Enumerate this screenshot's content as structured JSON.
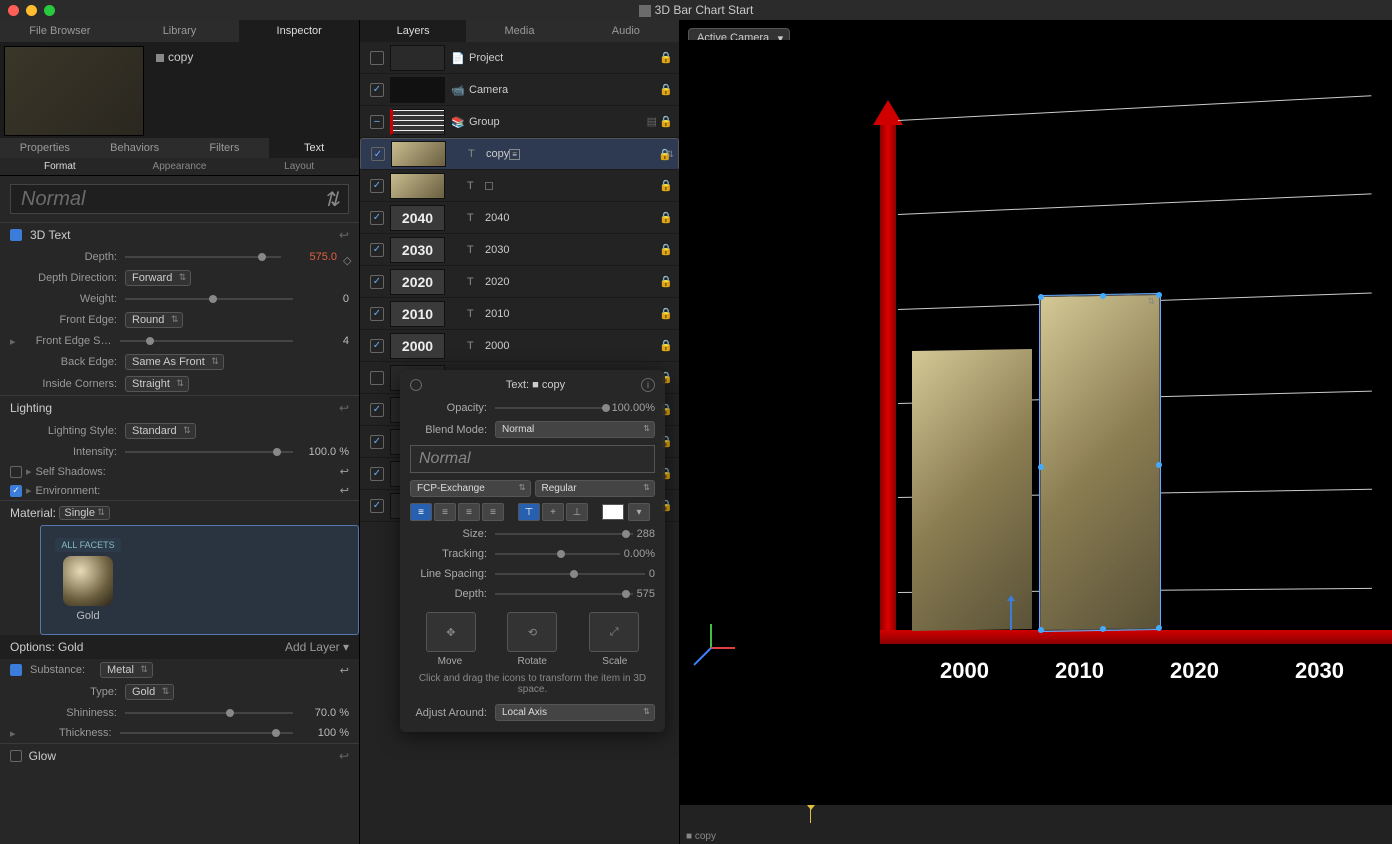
{
  "window": {
    "title": "3D Bar Chart Start"
  },
  "left_tabs": [
    "File Browser",
    "Library",
    "Inspector"
  ],
  "left_tab_active": 2,
  "preview": {
    "name": "copy"
  },
  "subtabs": [
    "Properties",
    "Behaviors",
    "Filters",
    "Text"
  ],
  "subtab_active": 3,
  "minitabs": [
    "Format",
    "Appearance",
    "Layout"
  ],
  "minitab_active": 0,
  "font_preview": "Normal",
  "sections": {
    "text3d": {
      "title": "3D Text",
      "depth_label": "Depth:",
      "depth_value": "575.0",
      "depth_dir_label": "Depth Direction:",
      "depth_dir_value": "Forward",
      "weight_label": "Weight:",
      "weight_value": "0",
      "front_edge_label": "Front Edge:",
      "front_edge_value": "Round",
      "front_edge_s_label": "Front Edge S…",
      "front_edge_s_value": "4",
      "back_edge_label": "Back Edge:",
      "back_edge_value": "Same As Front",
      "inside_label": "Inside Corners:",
      "inside_value": "Straight"
    },
    "lighting": {
      "title": "Lighting",
      "style_label": "Lighting Style:",
      "style_value": "Standard",
      "intensity_label": "Intensity:",
      "intensity_value": "100.0 %",
      "self_shadows": "Self Shadows:",
      "environment": "Environment:"
    },
    "material": {
      "title_label": "Material:",
      "title_value": "Single",
      "all_facets": "ALL FACETS",
      "name": "Gold",
      "options": "Options: Gold",
      "add_layer": "Add Layer",
      "substance_label": "Substance:",
      "substance_value": "Metal",
      "type_label": "Type:",
      "type_value": "Gold",
      "shininess_label": "Shininess:",
      "shininess_value": "70.0 %",
      "thickness_label": "Thickness:",
      "thickness_value": "100 %"
    },
    "glow": {
      "title": "Glow"
    }
  },
  "mid_tabs": [
    "Layers",
    "Media",
    "Audio"
  ],
  "mid_tab_active": 0,
  "layers": [
    {
      "check": false,
      "thumb": "",
      "indent": 0,
      "icon": "project",
      "name": "Project",
      "lock": true,
      "stack": false
    },
    {
      "check": true,
      "thumb": "chart",
      "indent": 0,
      "icon": "camera",
      "name": "Camera",
      "lock": true,
      "stack": false
    },
    {
      "check": "dash",
      "thumb": "lines",
      "indent": 0,
      "icon": "group",
      "name": "Group",
      "lock": true,
      "stack": true
    },
    {
      "check": true,
      "thumb": "bar",
      "indent": 1,
      "icon": "text",
      "name": "copy",
      "lock": true,
      "sel": true,
      "boxed": true
    },
    {
      "check": true,
      "thumb": "bar",
      "indent": 1,
      "icon": "text",
      "name": "",
      "lock": true,
      "box": true
    },
    {
      "check": true,
      "thumb": "2040",
      "indent": 1,
      "icon": "text",
      "name": "2040",
      "lock": true
    },
    {
      "check": true,
      "thumb": "2030",
      "indent": 1,
      "icon": "text",
      "name": "2030",
      "lock": true
    },
    {
      "check": true,
      "thumb": "2020",
      "indent": 1,
      "icon": "text",
      "name": "2020",
      "lock": true
    },
    {
      "check": true,
      "thumb": "2010",
      "indent": 1,
      "icon": "text",
      "name": "2010",
      "lock": true
    },
    {
      "check": true,
      "thumb": "2000",
      "indent": 1,
      "icon": "text",
      "name": "2000",
      "lock": true
    },
    {
      "check": false,
      "thumb": "",
      "indent": 1,
      "icon": "",
      "name": "",
      "lock": true
    },
    {
      "check": true,
      "thumb": "",
      "indent": 1,
      "icon": "",
      "name": "",
      "lock": true
    },
    {
      "check": true,
      "thumb": "",
      "indent": 1,
      "icon": "",
      "name": "",
      "lock": true
    },
    {
      "check": true,
      "thumb": "",
      "indent": 1,
      "icon": "",
      "name": "",
      "lock": true
    },
    {
      "check": true,
      "thumb": "",
      "indent": 1,
      "icon": "",
      "name": "",
      "lock": true
    }
  ],
  "hud": {
    "title": "Text: ■ copy",
    "opacity_label": "Opacity:",
    "opacity_value": "100.00%",
    "blend_label": "Blend Mode:",
    "blend_value": "Normal",
    "preview": "Normal",
    "font": "FCP-Exchange",
    "weight": "Regular",
    "size_label": "Size:",
    "size_value": "288",
    "tracking_label": "Tracking:",
    "tracking_value": "0.00%",
    "line_label": "Line Spacing:",
    "line_value": "0",
    "depth_label": "Depth:",
    "depth_value": "575",
    "move": "Move",
    "rotate": "Rotate",
    "scale": "Scale",
    "hint": "Click and drag the icons to transform\nthe item in 3D space.",
    "adjust_label": "Adjust Around:",
    "adjust_value": "Local Axis"
  },
  "viewport": {
    "camera": "Active Camera",
    "xlabels": [
      "2000",
      "2010",
      "2020",
      "2030"
    ],
    "bottom_sel": "■ copy"
  },
  "chart_data": {
    "type": "bar",
    "categories": [
      "2000",
      "2010",
      "2020",
      "2030",
      "2040"
    ],
    "values": [
      280,
      335,
      null,
      null,
      null
    ],
    "selected_index": 1,
    "title": "",
    "xlabel": "",
    "ylabel": ""
  }
}
